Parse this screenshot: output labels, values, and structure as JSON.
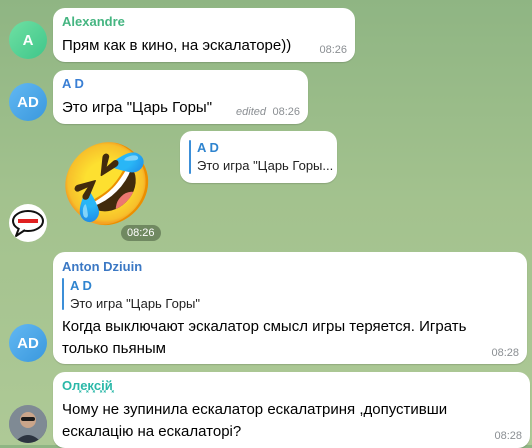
{
  "colors": {
    "alexandre": "#45b581",
    "ad": "#3a7fd4",
    "anton": "#3b78c4",
    "last_sender": "#2ab8a8",
    "quote_bar": "#3c8fd8"
  },
  "messages": [
    {
      "avatar_initials": "A",
      "sender": "Alexandre",
      "text": "Прям как в кино, на эскалаторе))",
      "time": "08:26"
    },
    {
      "avatar_initials": "AD",
      "sender": "A D",
      "text": "Это игра \"Царь Горы\"",
      "edited_label": "edited",
      "time": "08:26"
    },
    {
      "reply_preview": {
        "name": "A D",
        "text": "Это игра \"Царь Горы..."
      }
    },
    {
      "sticker": "rolling-on-floor-laughing-emoji",
      "sticker_glyph": "🤣",
      "time": "08:26",
      "avatar_icon": "speech-bubble-sticker-avatar"
    },
    {
      "sender": "Anton Dziuin",
      "quote": {
        "name": "A D",
        "text": "Это игра \"Царь Горы\""
      },
      "text_line1": "Когда выключают эскалатор смысл игры теряется. Играть",
      "text_line2": "только пьяным",
      "time": "08:28",
      "avatar_initials": "AD"
    },
    {
      "sender": "Ол͓е͓к͓с͓і͓й͓",
      "text_line1": "Чому не зупинила ескалатор ескалатриня ,допустивши",
      "text_line2": "ескалацію на ескалаторі?",
      "time": "08:28"
    }
  ]
}
